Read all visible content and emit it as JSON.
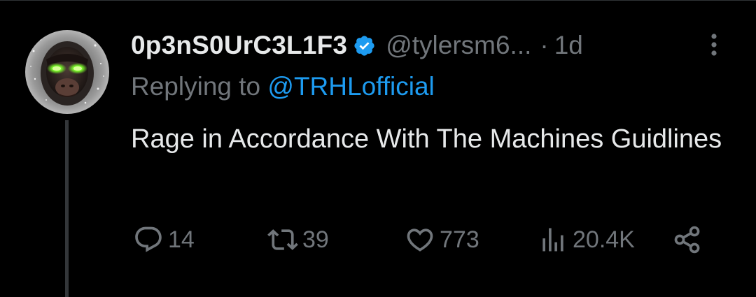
{
  "tweet": {
    "author": {
      "display_name": "0p3nS0UrC3L1F3",
      "handle": "@tylersm6...",
      "verified": true
    },
    "separator": "·",
    "time": "1d",
    "replying_label": "Replying to",
    "replying_to": "@TRHLofficial",
    "text": "Rage in Accordance With The Machines Guidlines"
  },
  "actions": {
    "replies": "14",
    "retweets": "39",
    "likes": "773",
    "views": "20.4K"
  },
  "icons": {
    "verified": "verified-badge-icon",
    "more": "more-vertical-icon",
    "reply": "reply-icon",
    "retweet": "retweet-icon",
    "like": "heart-icon",
    "views": "views-chart-icon",
    "share": "share-icon"
  },
  "colors": {
    "background": "#000000",
    "text": "#e7e9ea",
    "muted": "#71767b",
    "accent": "#1d9bf0",
    "avatar_eyes": "#7cff2a"
  }
}
